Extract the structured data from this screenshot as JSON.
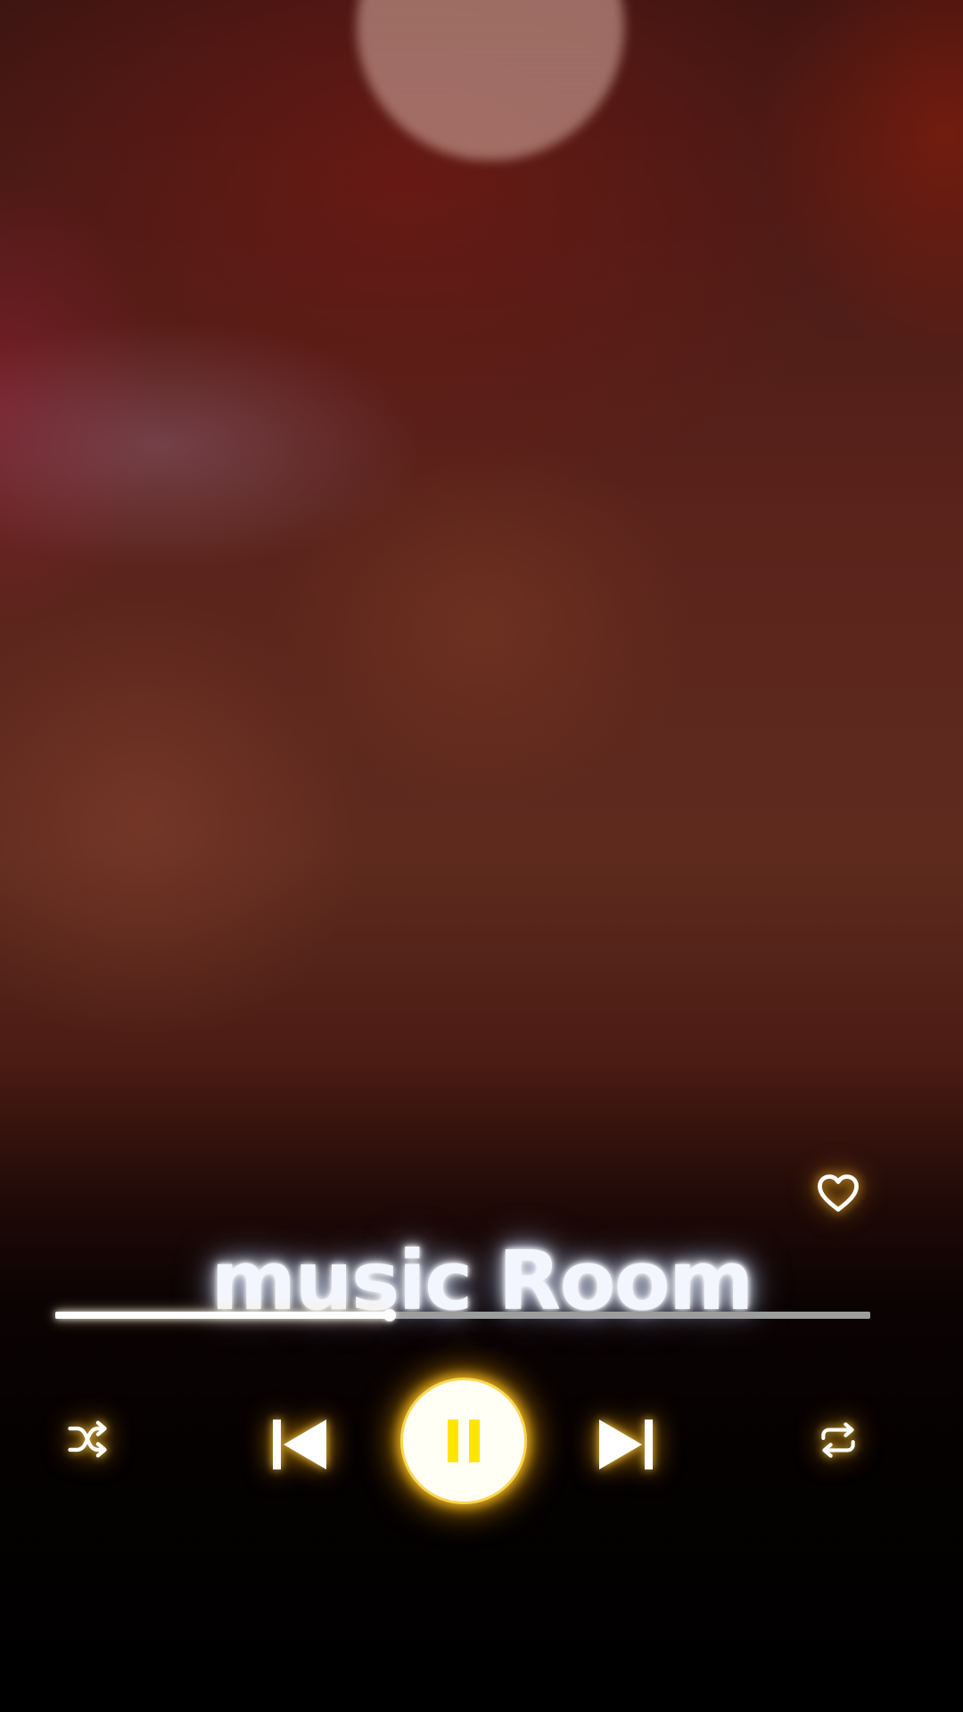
{
  "player": {
    "title": "music Room",
    "progress_fraction": 0.41,
    "is_playing": true,
    "liked": false
  },
  "controls": {
    "icons": [
      "heart-icon",
      "shuffle-icon",
      "previous-icon",
      "pause-icon",
      "next-icon",
      "repeat-icon"
    ]
  },
  "colors": {
    "accent_glow": "#ffb400",
    "pause_icon": "#ffe600",
    "play_button_bg": "#fffff6",
    "progress_track": "#9d9d9d",
    "progress_fill": "#ffffff"
  }
}
